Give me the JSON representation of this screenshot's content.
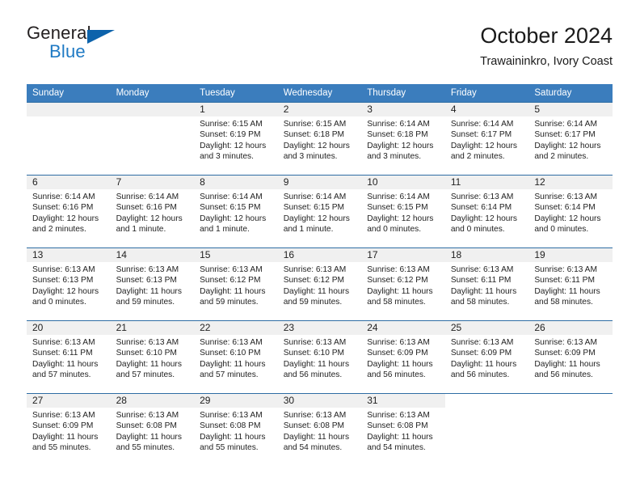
{
  "brand": {
    "name_part1": "General",
    "name_part2": "Blue",
    "triangle_color": "#0d63ab",
    "blue_color": "#1f7ac4"
  },
  "header": {
    "title": "October 2024",
    "subtitle": "Trawaininkro, Ivory Coast"
  },
  "theme": {
    "header_bg": "#3b7dbd",
    "row_border": "#2e6da4",
    "daynum_bg": "#f0f0f0"
  },
  "calendar": {
    "weekday_headers": [
      "Sunday",
      "Monday",
      "Tuesday",
      "Wednesday",
      "Thursday",
      "Friday",
      "Saturday"
    ],
    "labels": {
      "sunrise": "Sunrise:",
      "sunset": "Sunset:",
      "daylight": "Daylight:"
    },
    "weeks": [
      [
        {
          "day": "",
          "sunrise": "",
          "sunset": "",
          "daylight_line1": "",
          "daylight_line2": ""
        },
        {
          "day": "",
          "sunrise": "",
          "sunset": "",
          "daylight_line1": "",
          "daylight_line2": ""
        },
        {
          "day": "1",
          "sunrise": "Sunrise: 6:15 AM",
          "sunset": "Sunset: 6:19 PM",
          "daylight_line1": "Daylight: 12 hours",
          "daylight_line2": "and 3 minutes."
        },
        {
          "day": "2",
          "sunrise": "Sunrise: 6:15 AM",
          "sunset": "Sunset: 6:18 PM",
          "daylight_line1": "Daylight: 12 hours",
          "daylight_line2": "and 3 minutes."
        },
        {
          "day": "3",
          "sunrise": "Sunrise: 6:14 AM",
          "sunset": "Sunset: 6:18 PM",
          "daylight_line1": "Daylight: 12 hours",
          "daylight_line2": "and 3 minutes."
        },
        {
          "day": "4",
          "sunrise": "Sunrise: 6:14 AM",
          "sunset": "Sunset: 6:17 PM",
          "daylight_line1": "Daylight: 12 hours",
          "daylight_line2": "and 2 minutes."
        },
        {
          "day": "5",
          "sunrise": "Sunrise: 6:14 AM",
          "sunset": "Sunset: 6:17 PM",
          "daylight_line1": "Daylight: 12 hours",
          "daylight_line2": "and 2 minutes."
        }
      ],
      [
        {
          "day": "6",
          "sunrise": "Sunrise: 6:14 AM",
          "sunset": "Sunset: 6:16 PM",
          "daylight_line1": "Daylight: 12 hours",
          "daylight_line2": "and 2 minutes."
        },
        {
          "day": "7",
          "sunrise": "Sunrise: 6:14 AM",
          "sunset": "Sunset: 6:16 PM",
          "daylight_line1": "Daylight: 12 hours",
          "daylight_line2": "and 1 minute."
        },
        {
          "day": "8",
          "sunrise": "Sunrise: 6:14 AM",
          "sunset": "Sunset: 6:15 PM",
          "daylight_line1": "Daylight: 12 hours",
          "daylight_line2": "and 1 minute."
        },
        {
          "day": "9",
          "sunrise": "Sunrise: 6:14 AM",
          "sunset": "Sunset: 6:15 PM",
          "daylight_line1": "Daylight: 12 hours",
          "daylight_line2": "and 1 minute."
        },
        {
          "day": "10",
          "sunrise": "Sunrise: 6:14 AM",
          "sunset": "Sunset: 6:15 PM",
          "daylight_line1": "Daylight: 12 hours",
          "daylight_line2": "and 0 minutes."
        },
        {
          "day": "11",
          "sunrise": "Sunrise: 6:13 AM",
          "sunset": "Sunset: 6:14 PM",
          "daylight_line1": "Daylight: 12 hours",
          "daylight_line2": "and 0 minutes."
        },
        {
          "day": "12",
          "sunrise": "Sunrise: 6:13 AM",
          "sunset": "Sunset: 6:14 PM",
          "daylight_line1": "Daylight: 12 hours",
          "daylight_line2": "and 0 minutes."
        }
      ],
      [
        {
          "day": "13",
          "sunrise": "Sunrise: 6:13 AM",
          "sunset": "Sunset: 6:13 PM",
          "daylight_line1": "Daylight: 12 hours",
          "daylight_line2": "and 0 minutes."
        },
        {
          "day": "14",
          "sunrise": "Sunrise: 6:13 AM",
          "sunset": "Sunset: 6:13 PM",
          "daylight_line1": "Daylight: 11 hours",
          "daylight_line2": "and 59 minutes."
        },
        {
          "day": "15",
          "sunrise": "Sunrise: 6:13 AM",
          "sunset": "Sunset: 6:12 PM",
          "daylight_line1": "Daylight: 11 hours",
          "daylight_line2": "and 59 minutes."
        },
        {
          "day": "16",
          "sunrise": "Sunrise: 6:13 AM",
          "sunset": "Sunset: 6:12 PM",
          "daylight_line1": "Daylight: 11 hours",
          "daylight_line2": "and 59 minutes."
        },
        {
          "day": "17",
          "sunrise": "Sunrise: 6:13 AM",
          "sunset": "Sunset: 6:12 PM",
          "daylight_line1": "Daylight: 11 hours",
          "daylight_line2": "and 58 minutes."
        },
        {
          "day": "18",
          "sunrise": "Sunrise: 6:13 AM",
          "sunset": "Sunset: 6:11 PM",
          "daylight_line1": "Daylight: 11 hours",
          "daylight_line2": "and 58 minutes."
        },
        {
          "day": "19",
          "sunrise": "Sunrise: 6:13 AM",
          "sunset": "Sunset: 6:11 PM",
          "daylight_line1": "Daylight: 11 hours",
          "daylight_line2": "and 58 minutes."
        }
      ],
      [
        {
          "day": "20",
          "sunrise": "Sunrise: 6:13 AM",
          "sunset": "Sunset: 6:11 PM",
          "daylight_line1": "Daylight: 11 hours",
          "daylight_line2": "and 57 minutes."
        },
        {
          "day": "21",
          "sunrise": "Sunrise: 6:13 AM",
          "sunset": "Sunset: 6:10 PM",
          "daylight_line1": "Daylight: 11 hours",
          "daylight_line2": "and 57 minutes."
        },
        {
          "day": "22",
          "sunrise": "Sunrise: 6:13 AM",
          "sunset": "Sunset: 6:10 PM",
          "daylight_line1": "Daylight: 11 hours",
          "daylight_line2": "and 57 minutes."
        },
        {
          "day": "23",
          "sunrise": "Sunrise: 6:13 AM",
          "sunset": "Sunset: 6:10 PM",
          "daylight_line1": "Daylight: 11 hours",
          "daylight_line2": "and 56 minutes."
        },
        {
          "day": "24",
          "sunrise": "Sunrise: 6:13 AM",
          "sunset": "Sunset: 6:09 PM",
          "daylight_line1": "Daylight: 11 hours",
          "daylight_line2": "and 56 minutes."
        },
        {
          "day": "25",
          "sunrise": "Sunrise: 6:13 AM",
          "sunset": "Sunset: 6:09 PM",
          "daylight_line1": "Daylight: 11 hours",
          "daylight_line2": "and 56 minutes."
        },
        {
          "day": "26",
          "sunrise": "Sunrise: 6:13 AM",
          "sunset": "Sunset: 6:09 PM",
          "daylight_line1": "Daylight: 11 hours",
          "daylight_line2": "and 56 minutes."
        }
      ],
      [
        {
          "day": "27",
          "sunrise": "Sunrise: 6:13 AM",
          "sunset": "Sunset: 6:09 PM",
          "daylight_line1": "Daylight: 11 hours",
          "daylight_line2": "and 55 minutes."
        },
        {
          "day": "28",
          "sunrise": "Sunrise: 6:13 AM",
          "sunset": "Sunset: 6:08 PM",
          "daylight_line1": "Daylight: 11 hours",
          "daylight_line2": "and 55 minutes."
        },
        {
          "day": "29",
          "sunrise": "Sunrise: 6:13 AM",
          "sunset": "Sunset: 6:08 PM",
          "daylight_line1": "Daylight: 11 hours",
          "daylight_line2": "and 55 minutes."
        },
        {
          "day": "30",
          "sunrise": "Sunrise: 6:13 AM",
          "sunset": "Sunset: 6:08 PM",
          "daylight_line1": "Daylight: 11 hours",
          "daylight_line2": "and 54 minutes."
        },
        {
          "day": "31",
          "sunrise": "Sunrise: 6:13 AM",
          "sunset": "Sunset: 6:08 PM",
          "daylight_line1": "Daylight: 11 hours",
          "daylight_line2": "and 54 minutes."
        },
        {
          "day": "",
          "sunrise": "",
          "sunset": "",
          "daylight_line1": "",
          "daylight_line2": ""
        },
        {
          "day": "",
          "sunrise": "",
          "sunset": "",
          "daylight_line1": "",
          "daylight_line2": ""
        }
      ]
    ]
  }
}
